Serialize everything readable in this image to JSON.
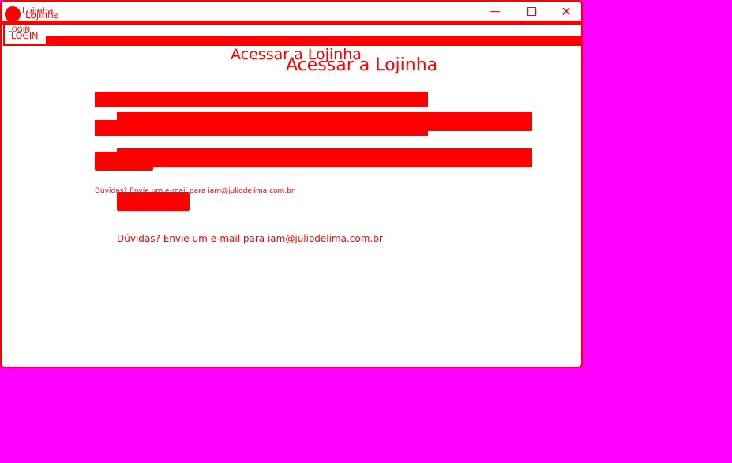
{
  "window": {
    "title": "Lojinha",
    "title_ghost": "Lojinha",
    "controls": {
      "minimize_icon": "minimize-icon",
      "maximize_icon": "maximize-icon",
      "close_icon": "close-icon",
      "close_glyph": "✕",
      "minimize_glyph": "—"
    }
  },
  "tab": {
    "ghost_label": "LOGIN",
    "label": "LOGIN"
  },
  "login": {
    "heading_ghost": "Acessar a Lojinha",
    "heading": "Acessar a Lojinha",
    "username_value": "",
    "password_value": "",
    "submit_label": "",
    "help_ghost": "Dúvidas? Envie um e-mail para iam@juliodelima.com.br",
    "help_text": "Dúvidas? Envie um e-mail para",
    "help_email": "iam@juliodelima.com.br"
  },
  "colors": {
    "accent": "#ff0000",
    "background": "#ff00ff",
    "window_bg": "#ffffff"
  }
}
